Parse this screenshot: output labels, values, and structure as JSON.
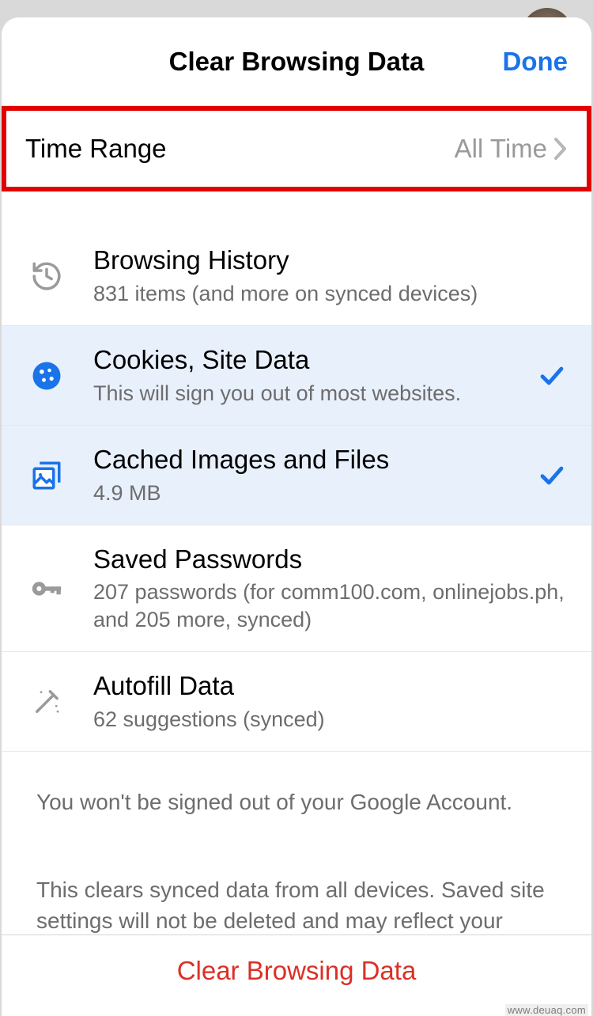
{
  "header": {
    "title": "Clear Browsing Data",
    "done": "Done"
  },
  "time_range": {
    "label": "Time Range",
    "value": "All Time"
  },
  "items": [
    {
      "title": "Browsing History",
      "subtitle": "831 items (and more on synced devices)"
    },
    {
      "title": "Cookies, Site Data",
      "subtitle": "This will sign you out of most websites."
    },
    {
      "title": "Cached Images and Files",
      "subtitle": "4.9 MB"
    },
    {
      "title": "Saved Passwords",
      "subtitle": "207 passwords (for comm100.com, onlinejobs.ph, and 205 more, synced)"
    },
    {
      "title": "Autofill Data",
      "subtitle": "62 suggestions (synced)"
    }
  ],
  "footer": {
    "note1": "You won't be signed out of your Google Account.",
    "note2": "This clears synced data from all devices. Saved site settings will not be deleted and may reflect your"
  },
  "clear_button": "Clear Browsing Data",
  "watermark": "www.deuaq.com"
}
